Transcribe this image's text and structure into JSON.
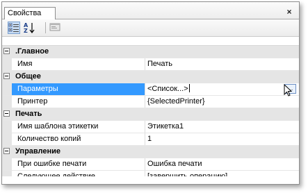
{
  "panel": {
    "tab_label": "Свойства",
    "close_glyph": "×"
  },
  "toolbar": {
    "categorized": "categorized-view-icon",
    "alphabetical": "sort-az-icon",
    "property_pages": "property-pages-icon"
  },
  "categories": [
    {
      "name": ".Главное",
      "properties": [
        {
          "name": "Имя",
          "value": "Печать"
        }
      ]
    },
    {
      "name": "Общее",
      "properties": [
        {
          "name": "Параметры",
          "value": "<Список...>",
          "selected": true
        },
        {
          "name": "Принтер",
          "value": "{SelectedPrinter}"
        }
      ]
    },
    {
      "name": "Печать",
      "properties": [
        {
          "name": "Имя шаблона этикетки",
          "value": "Этикетка1"
        },
        {
          "name": "Количество копий",
          "value": "1"
        }
      ]
    },
    {
      "name": "Управление",
      "properties": [
        {
          "name": "При ошибке печати",
          "value": "Ошибка печати"
        },
        {
          "name": "Следующее действие",
          "value": "[завершить операцию]"
        }
      ]
    }
  ],
  "ellipsis_button": "..."
}
